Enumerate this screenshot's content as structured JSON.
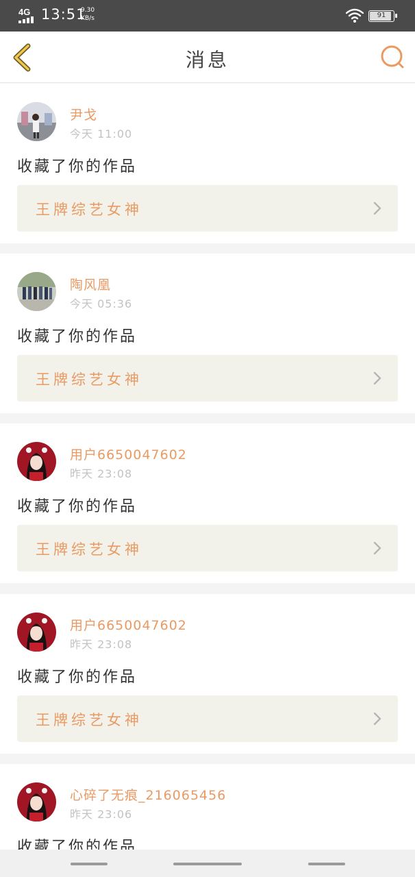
{
  "status_bar": {
    "network": "4G",
    "time": "13:51",
    "speed_value": "9.30",
    "speed_unit": "KB/s",
    "battery": "91",
    "battery_level": 0.91
  },
  "header": {
    "title": "消息",
    "back_icon": "chevron-left-icon",
    "search_icon": "search-icon"
  },
  "messages": [
    {
      "user": "尹戈",
      "time": "今天 11:00",
      "action": "收藏了你的作品",
      "work": "王牌综艺女神"
    },
    {
      "user": "陶风凰",
      "time": "今天 05:36",
      "action": "收藏了你的作品",
      "work": "王牌综艺女神"
    },
    {
      "user": "用户6650047602",
      "time": "昨天 23:08",
      "action": "收藏了你的作品",
      "work": "王牌综艺女神"
    },
    {
      "user": "用户6650047602",
      "time": "昨天 23:08",
      "action": "收藏了你的作品",
      "work": "王牌综艺女神"
    },
    {
      "user": "心碎了无痕_216065456",
      "time": "昨天 23:06",
      "action": "收藏了你的作品",
      "work": ""
    }
  ],
  "colors": {
    "accent": "#e99a63",
    "card_bg": "#f3f2ea",
    "status_bar_bg": "#4a4a4a",
    "divider": "#f4f4f4"
  }
}
